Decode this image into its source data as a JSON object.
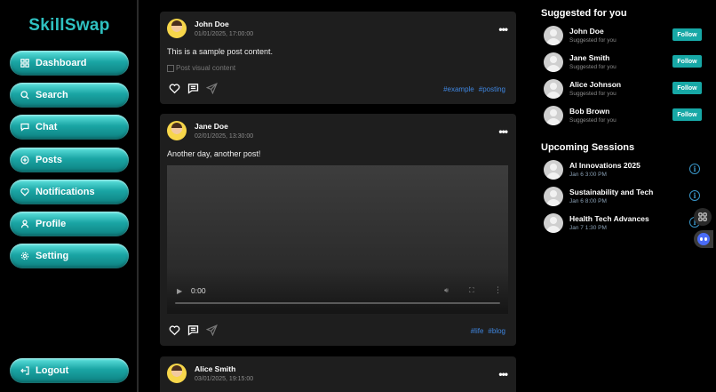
{
  "app": {
    "title": "SkillSwap"
  },
  "sidebar": {
    "items": [
      {
        "label": "Dashboard",
        "icon": "grid-icon"
      },
      {
        "label": "Search",
        "icon": "search-icon"
      },
      {
        "label": "Chat",
        "icon": "chat-icon"
      },
      {
        "label": "Posts",
        "icon": "plus-circle-icon"
      },
      {
        "label": "Notifications",
        "icon": "heart-icon"
      },
      {
        "label": "Profile",
        "icon": "user-icon"
      },
      {
        "label": "Setting",
        "icon": "gear-icon"
      }
    ],
    "logout": {
      "label": "Logout",
      "icon": "logout-icon"
    }
  },
  "posts": [
    {
      "author": "John Doe",
      "timestamp": "01/01/2025, 17:00:00",
      "text": "This is a sample post content.",
      "image_alt": "Post visual content",
      "tags": [
        "#example",
        "#posting"
      ]
    },
    {
      "author": "Jane Doe",
      "timestamp": "02/01/2025, 13:30:00",
      "text": "Another day, another post!",
      "video_time": "0:00",
      "tags": [
        "#life",
        "#blog"
      ]
    },
    {
      "author": "Alice Smith",
      "timestamp": "03/01/2025, 19:15:00"
    }
  ],
  "suggested": {
    "title": "Suggested for you",
    "follow_label": "Follow",
    "users": [
      {
        "name": "John Doe",
        "sub": "Suggested for you"
      },
      {
        "name": "Jane Smith",
        "sub": "Suggested for you"
      },
      {
        "name": "Alice Johnson",
        "sub": "Suggested for you"
      },
      {
        "name": "Bob Brown",
        "sub": "Suggested for you"
      }
    ]
  },
  "sessions": {
    "title": "Upcoming Sessions",
    "items": [
      {
        "name": "AI Innovations 2025",
        "time": "Jan 6 3:00 PM"
      },
      {
        "name": "Sustainability and Tech",
        "time": "Jan 6 8:00 PM"
      },
      {
        "name": "Health Tech Advances",
        "time": "Jan 7 1:30 PM"
      }
    ]
  },
  "colors": {
    "accent": "#17a8a6",
    "tag": "#3f86e0",
    "card": "#1e1e1e"
  }
}
